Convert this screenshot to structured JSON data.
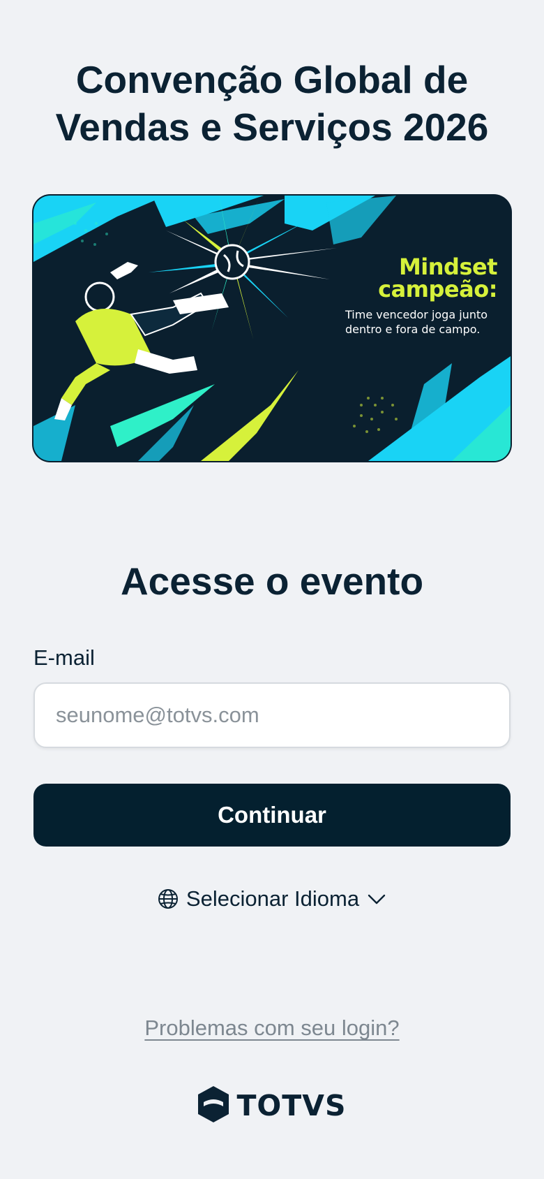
{
  "header": {
    "title": "Convenção Global de Vendas e Serviços 2026"
  },
  "banner": {
    "headline_line1": "Mindset",
    "headline_line2": "campeão:",
    "subtitle_line1": "Time vencedor joga junto",
    "subtitle_line2": "dentro e fora de campo.",
    "colors": {
      "background": "#0a1f2e",
      "cyan": "#19d3f5",
      "lime": "#d6f13b",
      "mint": "#2ff0c8"
    }
  },
  "login": {
    "section_title": "Acesse o evento",
    "email_label": "E-mail",
    "email_value": "",
    "email_placeholder": "seunome@totvs.com",
    "continue_label": "Continuar",
    "language_label": "Selecionar Idioma",
    "language_icon": "globe-icon",
    "chevron_icon": "chevron-down-icon",
    "help_link": "Problemas com seu login?"
  },
  "footer": {
    "brand_name": "TOTVS",
    "brand_icon": "totvs-logo-icon"
  },
  "colors": {
    "page_background": "#f0f2f5",
    "primary": "#04202f",
    "text": "#0b2233",
    "muted_link": "#7d8790"
  }
}
